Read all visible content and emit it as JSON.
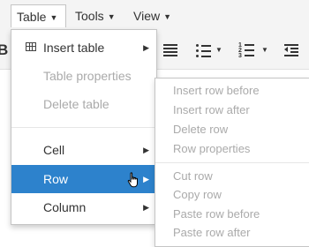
{
  "menubar": {
    "items": [
      {
        "label": "Table"
      },
      {
        "label": "Tools"
      },
      {
        "label": "View"
      }
    ]
  },
  "toolbar": {
    "bold_label": "B"
  },
  "table_menu": {
    "items": [
      {
        "label": "Insert table",
        "enabled": true,
        "submenu": true
      },
      {
        "label": "Table properties",
        "enabled": false
      },
      {
        "label": "Delete table",
        "enabled": false
      },
      {
        "label": "Cell",
        "enabled": true,
        "submenu": true
      },
      {
        "label": "Row",
        "enabled": true,
        "submenu": true,
        "highlighted": true
      },
      {
        "label": "Column",
        "enabled": true,
        "submenu": true
      }
    ]
  },
  "row_submenu": {
    "items": [
      {
        "label": "Insert row before",
        "enabled": false
      },
      {
        "label": "Insert row after",
        "enabled": false
      },
      {
        "label": "Delete row",
        "enabled": false
      },
      {
        "label": "Row properties",
        "enabled": false
      },
      {
        "label": "Cut row",
        "enabled": false
      },
      {
        "label": "Copy row",
        "enabled": false
      },
      {
        "label": "Paste row before",
        "enabled": false
      },
      {
        "label": "Paste row after",
        "enabled": false
      }
    ]
  },
  "colors": {
    "highlight": "#2d82cc",
    "disabled_text": "#aaaaaa",
    "text": "#333333"
  }
}
